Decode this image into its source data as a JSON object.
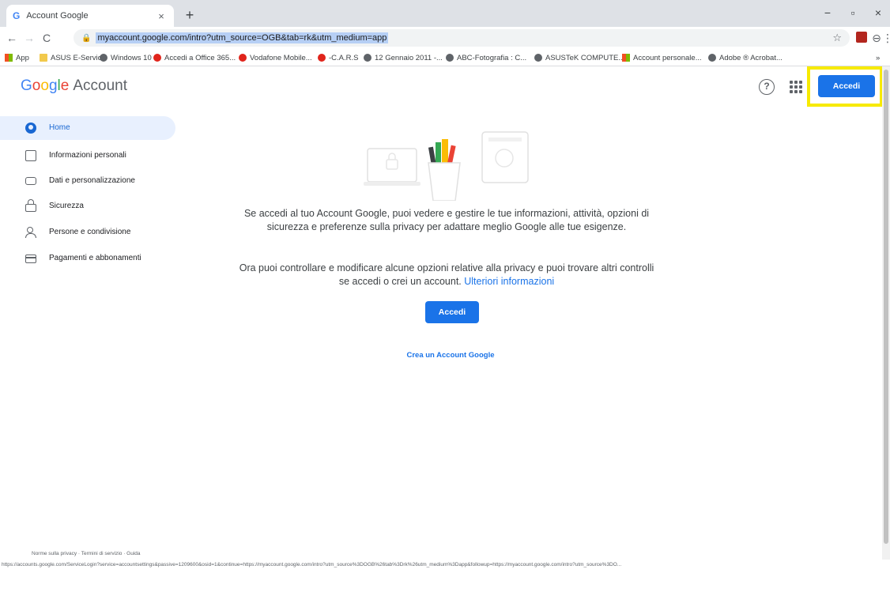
{
  "browser": {
    "tab": {
      "favicon": "G",
      "title": "Account Google",
      "close": "×"
    },
    "new_tab": "+",
    "window": {
      "minimize": "−",
      "maximize": "▫",
      "close": "×"
    },
    "nav": {
      "back": "←",
      "forward": "→",
      "reload": "C"
    },
    "omnibox": {
      "lock_icon": "🔒",
      "url": "myaccount.google.com/intro?utm_source=OGB&tab=rk&utm_medium=app",
      "star": "☆"
    },
    "profile_icon": "⊖",
    "menu_icon": "⋮",
    "bookmarks": [
      {
        "label": "App",
        "icon": "grid"
      },
      {
        "label": "ASUS E-Service",
        "icon": "folder"
      },
      {
        "label": "Windows 10",
        "icon": "globe"
      },
      {
        "label": "Accedi a Office 365...",
        "icon": "red"
      },
      {
        "label": "Vodafone Mobile...",
        "icon": "red"
      },
      {
        "label": "-C.A.R.S",
        "icon": "red"
      },
      {
        "label": "12 Gennaio 2011 -...",
        "icon": "globe"
      },
      {
        "label": "ABC-Fotografia : C...",
        "icon": "globe"
      },
      {
        "label": "ASUSTeK COMPUTE...",
        "icon": "globe"
      },
      {
        "label": "Account personale...",
        "icon": "grid"
      },
      {
        "label": "Adobe ® Acrobat...",
        "icon": "globe"
      }
    ],
    "bookmarks_more": "»"
  },
  "header": {
    "logo": {
      "G": "G",
      "o1": "o",
      "o2": "o",
      "g": "g",
      "l": "l",
      "e": "e",
      "suffix": "Account"
    },
    "help_icon": "?",
    "signin_label": "Accedi"
  },
  "sidebar": {
    "items": [
      {
        "label": "Home"
      },
      {
        "label": "Informazioni personali"
      },
      {
        "label": "Dati e personalizzazione"
      },
      {
        "label": "Sicurezza"
      },
      {
        "label": "Persone e condivisione"
      },
      {
        "label": "Pagamenti e abbonamenti"
      }
    ]
  },
  "main": {
    "paragraph1": "Se accedi al tuo Account Google, puoi vedere e gestire le tue informazioni, attività, opzioni di sicurezza e preferenze sulla privacy per adattare meglio Google alle tue esigenze.",
    "paragraph2": "Ora puoi controllare e modificare alcune opzioni relative alla privacy e puoi trovare altri controlli se accedi o crei un account.",
    "learn_more": "Ulteriori informazioni",
    "signin_label": "Accedi",
    "create_account": "Crea un Account Google"
  },
  "footer": {
    "links": "Norme sulla privacy  ·  Termini di servizio  ·  Guida"
  },
  "statusbar": {
    "url": "https://accounts.google.com/ServiceLogin?service=accountsettings&passive=1209600&osid=1&continue=https://myaccount.google.com/intro?utm_source%3DOGB%26tab%3Drk%26utm_medium%3Dapp&followup=https://myaccount.google.com/intro?utm_source%3DO..."
  },
  "colors": {
    "accent": "#1a73e8",
    "highlight": "#f7ea00",
    "active_bg": "#e8f0fe"
  }
}
